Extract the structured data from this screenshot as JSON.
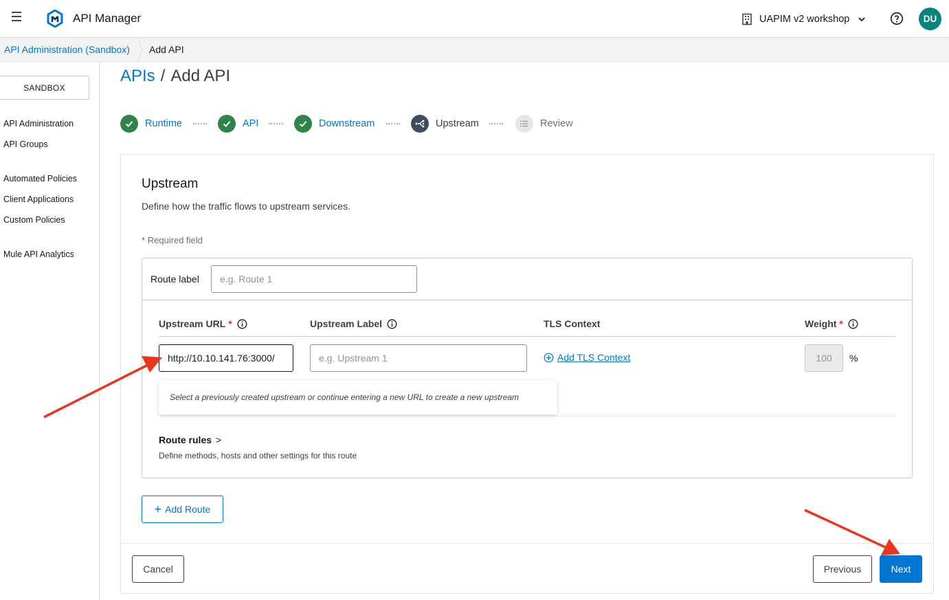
{
  "header": {
    "app_title": "API Manager",
    "org_name": "UAPIM v2 workshop",
    "avatar_initials": "DU",
    "avatar_color": "#0b827c"
  },
  "breadcrumb": {
    "parent": "API Administration (Sandbox)",
    "current": "Add API"
  },
  "sidebar": {
    "environment": "SANDBOX",
    "items": [
      {
        "label": "API Administration"
      },
      {
        "label": "API Groups"
      },
      {
        "label": "Automated Policies"
      },
      {
        "label": "Client Applications"
      },
      {
        "label": "Custom Policies"
      },
      {
        "label": "Mule API Analytics"
      }
    ]
  },
  "page": {
    "title_link": "APIs",
    "title_sep": "/",
    "title_current": "Add API"
  },
  "stepper": [
    {
      "label": "Runtime",
      "state": "done"
    },
    {
      "label": "API",
      "state": "done"
    },
    {
      "label": "Downstream",
      "state": "done"
    },
    {
      "label": "Upstream",
      "state": "active"
    },
    {
      "label": "Review",
      "state": "todo"
    }
  ],
  "form": {
    "section_title": "Upstream",
    "section_desc": "Define how the traffic flows to upstream services.",
    "required_star": "*",
    "required_note": "Required field",
    "route_label": "Route label",
    "route_label_placeholder": "e.g. Route 1",
    "columns": {
      "url": "Upstream URL",
      "label": "Upstream Label",
      "tls": "TLS Context",
      "weight": "Weight"
    },
    "upstream_url_value": "http://10.10.141.76:3000/",
    "upstream_label_placeholder": "e.g. Upstream 1",
    "add_tls": "Add TLS Context",
    "weight_value": "100",
    "weight_unit": "%",
    "suggestion": "Select a previously created upstream or continue entering a new URL to create a new upstream",
    "route_rules": "Route rules",
    "route_rules_chevron": ">",
    "route_rules_desc": "Define methods, hosts and other settings for this route",
    "add_route": "Add Route"
  },
  "footer": {
    "cancel": "Cancel",
    "previous": "Previous",
    "next": "Next"
  },
  "colors": {
    "brand_blue": "#0176d3",
    "success_green": "#2e844a",
    "annotation_red": "#e8361f"
  }
}
